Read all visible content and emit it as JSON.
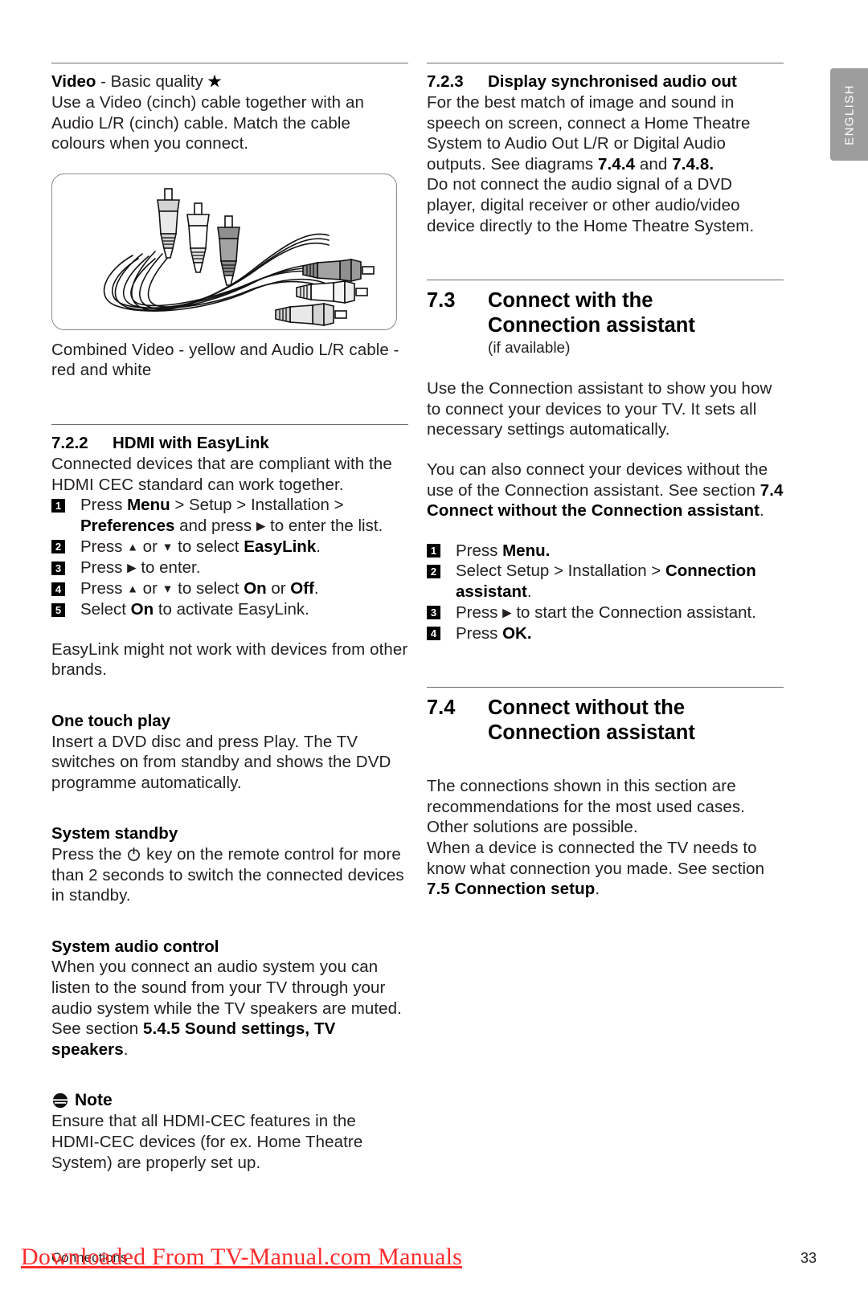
{
  "side_tab": {
    "label": "ENGLISH"
  },
  "left_column": {
    "video_section": {
      "heading_bold": "Video",
      "heading_rest": " - Basic quality ",
      "star_glyph": "★",
      "body": "Use a Video (cinch) cable together with an Audio L/R (cinch) cable. Match the cable colours when you connect.",
      "figure_alt": "combined-video-audio-rca-cable",
      "caption": "Combined Video - yellow and Audio L/R cable - red and white"
    },
    "hdmi_section": {
      "number": "7.2.2",
      "title": "HDMI with EasyLink",
      "intro": "Connected devices that are compliant with the HDMI CEC standard can work together.",
      "steps": [
        {
          "n": "1",
          "parts": [
            "Press ",
            "Menu",
            " > Setup > Installation > ",
            "Preferences",
            " and press ",
            "▶",
            " to enter the list."
          ]
        },
        {
          "n": "2",
          "parts": [
            "Press ",
            "▲",
            " or ",
            "▼",
            " to select ",
            "EasyLink",
            "."
          ]
        },
        {
          "n": "3",
          "parts": [
            "Press ",
            "▶",
            " to enter."
          ]
        },
        {
          "n": "4",
          "parts": [
            "Press ",
            "▲",
            " or ",
            "▼",
            " to select ",
            "On",
            " or ",
            "Off",
            "."
          ]
        },
        {
          "n": "5",
          "parts": [
            "Select ",
            "On",
            " to activate EasyLink."
          ]
        }
      ],
      "note_after_steps": "EasyLink might not work with devices from other brands."
    },
    "one_touch_play": {
      "heading": "One touch play",
      "body": "Insert a DVD disc and press Play. The TV switches on from standby and shows the DVD programme automatically."
    },
    "system_standby": {
      "heading": "System standby",
      "body_before_icon": "Press the ",
      "icon": "power-standby-icon",
      "body_after_icon": " key on the remote control for more than 2 seconds to switch the connected devices in standby."
    },
    "system_audio_control": {
      "heading": "System audio control",
      "body_plain": "When you connect an audio system you can listen to the sound from your TV through your audio system while the TV speakers are muted. See section ",
      "body_bold": "5.4.5 Sound settings, TV speakers",
      "body_end": "."
    },
    "note_block": {
      "icon": "note-icon",
      "heading": "Note",
      "body": "Ensure that all HDMI-CEC features in the HDMI-CEC devices (for ex. Home Theatre System) are properly set up."
    }
  },
  "right_column": {
    "audio_out_section": {
      "number": "7.2.3",
      "title": "Display synchronised audio out",
      "para1_a": "For the best match of image and sound in speech on screen, connect a Home Theatre System to Audio Out L/R or Digital Audio outputs. See diagrams ",
      "para1_b1": "7.4.4",
      "para1_mid": " and ",
      "para1_b2": "7.4.8.",
      "para2": "Do not connect the audio signal of a DVD player, digital receiver or other audio/video device directly to the Home Theatre System."
    },
    "section_7_3": {
      "number": "7.3",
      "title_line1": "Connect with the",
      "title_line2": "Connection assistant",
      "subtitle": "(if available)",
      "para1": "Use the Connection assistant to show you how to connect your devices to your TV. It sets all necessary settings automatically.",
      "para2_a": "You can also connect your devices without the use of the Connection assistant. See section ",
      "para2_b1": "7.4",
      "para2_b2": "Connect without the Connection assistant",
      "para2_end": ".",
      "steps": [
        {
          "n": "1",
          "parts": [
            "Press ",
            "Menu",
            "."
          ]
        },
        {
          "n": "2",
          "parts": [
            "Select Setup > Installation > ",
            "Connection assistant",
            "."
          ]
        },
        {
          "n": "3",
          "parts": [
            "Press ",
            "▶",
            " to start the Connection assistant."
          ]
        },
        {
          "n": "4",
          "parts": [
            "Press ",
            "OK",
            "."
          ]
        }
      ]
    },
    "section_7_4": {
      "number": "7.4",
      "title_line1": "Connect without the",
      "title_line2": "Connection assistant",
      "para1": "The connections shown in this section are recommendations for the most used cases. Other solutions are possible.",
      "para2_a": "When a device is connected the TV needs to know what connection you made. See section ",
      "para2_b1": "7.5",
      "para2_b2": "Connection setup",
      "para2_end": "."
    }
  },
  "footer": {
    "chapter": "Connections",
    "page_number": "33",
    "watermark": "Downloaded From TV-Manual.com Manuals",
    "watermark_color": "#ff2d2d"
  }
}
